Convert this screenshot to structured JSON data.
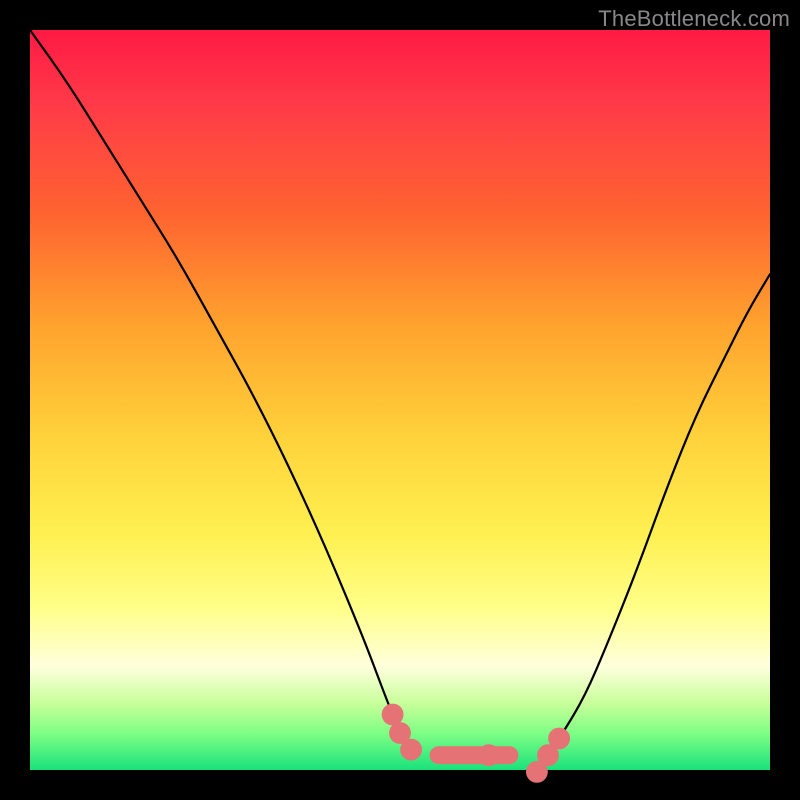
{
  "watermark": "TheBottleneck.com",
  "colors": {
    "page_bg": "#000000",
    "gradient_top": "#ff1a44",
    "gradient_bottom": "#19e27b",
    "curve": "#000000",
    "bead": "#e57274"
  },
  "chart_data": {
    "type": "line",
    "title": "",
    "xlabel": "",
    "ylabel": "",
    "xlim": [
      0,
      100
    ],
    "ylim": [
      0,
      100
    ],
    "grid": false,
    "legend": false,
    "series": [
      {
        "name": "left-curve",
        "x": [
          0,
          5,
          10,
          15,
          20,
          25,
          30,
          35,
          40,
          45,
          48,
          50,
          52
        ],
        "values": [
          100,
          93,
          85,
          77,
          69,
          60,
          51,
          41,
          30,
          18,
          10,
          5,
          2
        ]
      },
      {
        "name": "right-curve",
        "x": [
          70,
          72,
          75,
          78,
          82,
          86,
          90,
          94,
          97,
          100
        ],
        "values": [
          2,
          5,
          10,
          17,
          27,
          38,
          48,
          56,
          62,
          67
        ]
      },
      {
        "name": "flat-bottom",
        "x": [
          52,
          56,
          60,
          64,
          68,
          70
        ],
        "values": [
          2,
          2,
          2,
          2,
          2,
          2
        ]
      }
    ],
    "markers": {
      "left_beads_x": [
        49,
        50,
        51.5
      ],
      "right_beads_x": [
        68.5,
        70,
        71.5
      ],
      "bottom_bar_x": [
        54,
        66
      ],
      "bottom_mid_bead_x": 62,
      "bead_radius": 1.4,
      "bar_half_height": 1.2
    }
  }
}
